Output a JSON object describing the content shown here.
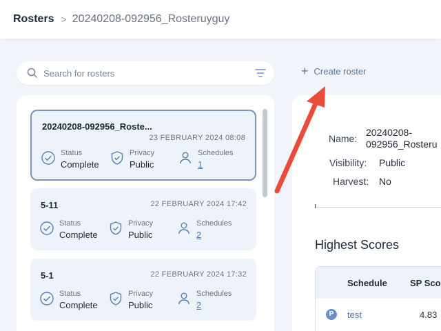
{
  "breadcrumb": {
    "root": "Rosters",
    "separator": ">",
    "current": "20240208-092956_Rosteruyguy"
  },
  "search": {
    "placeholder": "Search for rosters",
    "value": ""
  },
  "create_button": {
    "label": "Create roster"
  },
  "rosters": [
    {
      "name": "20240208-092956_Roste...",
      "date": "23 FEBRUARY 2024 08:08",
      "status_label": "Status",
      "status": "Complete",
      "privacy_label": "Privacy",
      "privacy": "Public",
      "schedules_label": "Schedules",
      "schedules": "1",
      "selected": true
    },
    {
      "name": "5-11",
      "date": "22 FEBRUARY 2024 17:42",
      "status_label": "Status",
      "status": "Complete",
      "privacy_label": "Privacy",
      "privacy": "Public",
      "schedules_label": "Schedules",
      "schedules": "2",
      "selected": false
    },
    {
      "name": "5-1",
      "date": "22 FEBRUARY 2024 17:32",
      "status_label": "Status",
      "status": "Complete",
      "privacy_label": "Privacy",
      "privacy": "Public",
      "schedules_label": "Schedules",
      "schedules": "2",
      "selected": false
    }
  ],
  "detail": {
    "name_label": "Name:",
    "name_line1": "20240208-",
    "name_line2": "092956_Rosteru",
    "visibility_label": "Visibility:",
    "visibility": "Public",
    "harvest_label": "Harvest:",
    "harvest": "No"
  },
  "highest_scores": {
    "title": "Highest Scores",
    "columns": [
      "Schedule",
      "SP Sco"
    ],
    "rows": [
      {
        "badge": "P",
        "schedule": "test",
        "score": "4.83"
      }
    ]
  },
  "colors": {
    "accent": "#4d78a8",
    "card_bg": "#eef3fb",
    "arrow": "#ea4c3c"
  }
}
